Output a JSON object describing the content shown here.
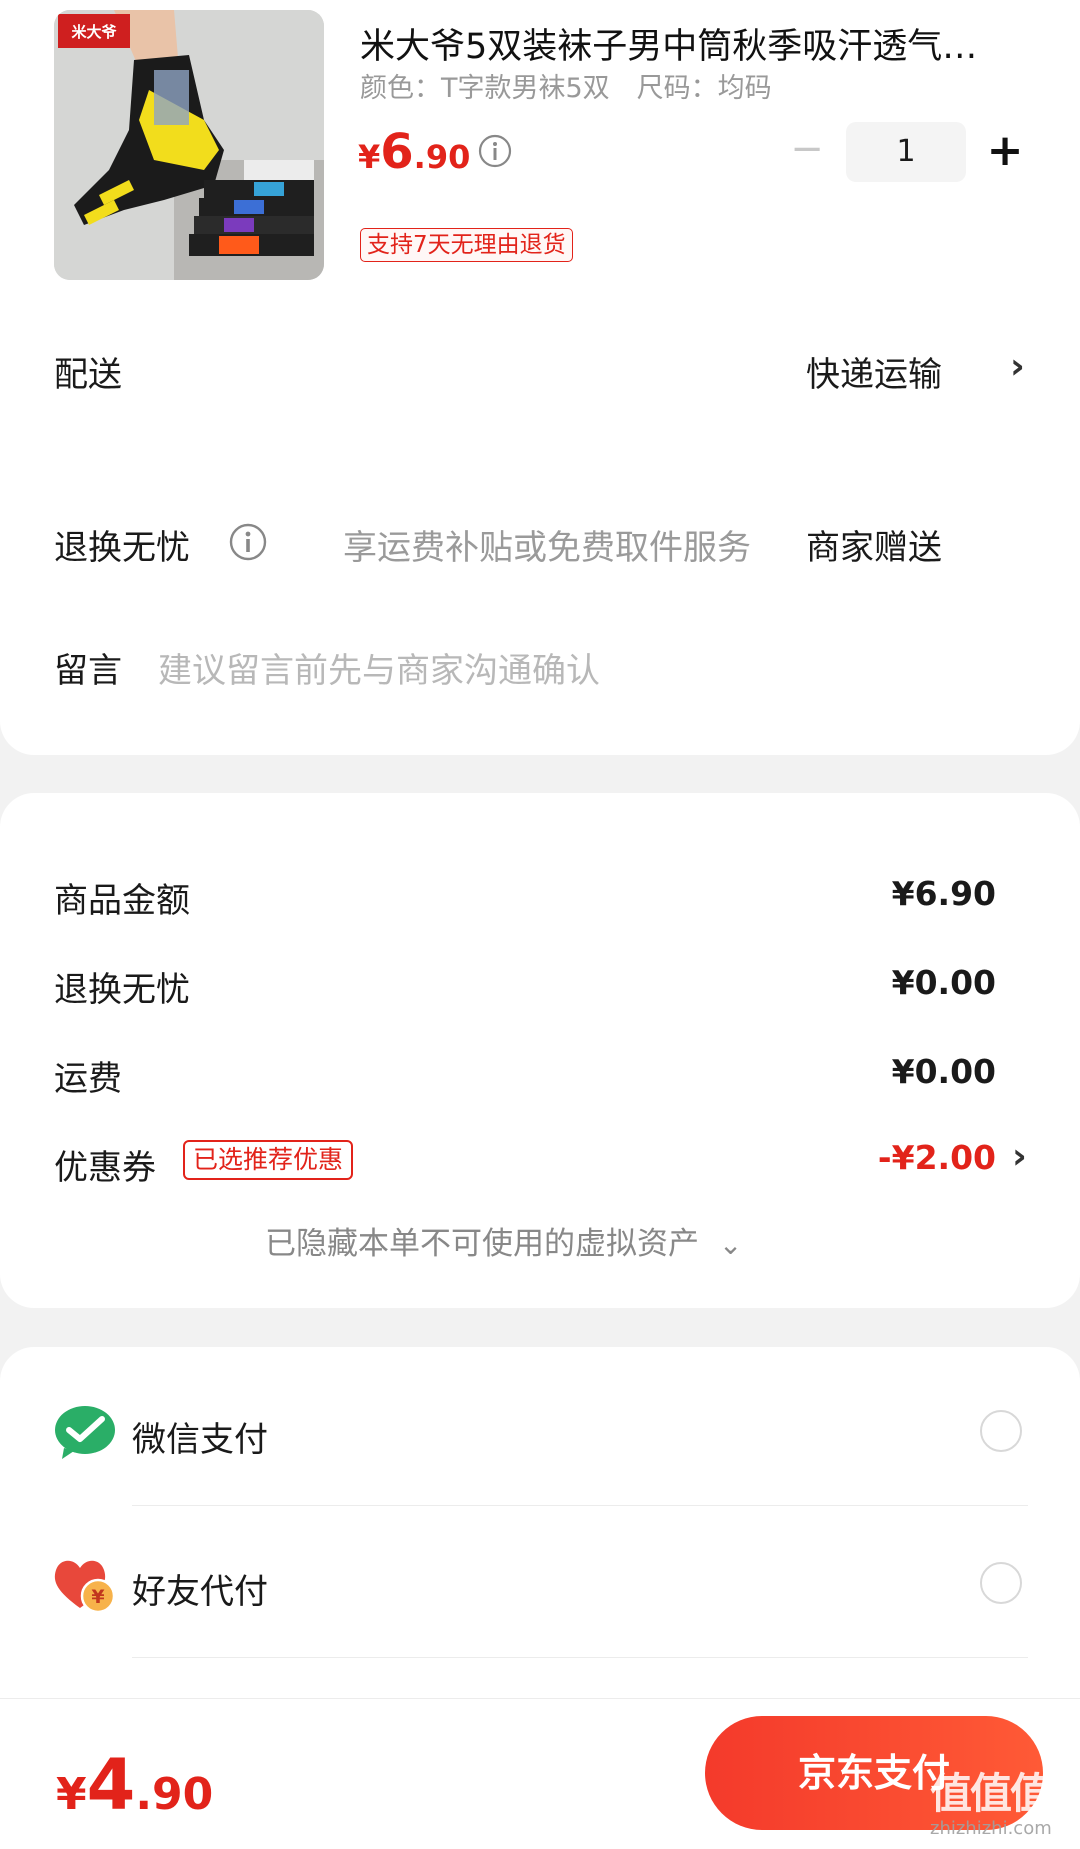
{
  "product": {
    "brand_tag": "米大爷",
    "title": "米大爷5双装袜子男中筒秋季吸汗透气…",
    "spec": "颜色：T字款男袜5双　尺码：均码",
    "price": {
      "currency": "¥",
      "integer": "6",
      "decimal": ".90"
    },
    "quantity": "1",
    "minus": "−",
    "plus": "+",
    "return_tag": "支持7天无理由退货"
  },
  "delivery": {
    "label": "配送",
    "value": "快递运输",
    "chevron": "›"
  },
  "worry_free": {
    "label": "退换无忧",
    "description": "享运费补贴或免费取件服务",
    "value": "商家赠送"
  },
  "note": {
    "label": "留言",
    "placeholder": "建议留言前先与商家沟通确认"
  },
  "summary": {
    "rows": [
      {
        "label": "商品金额",
        "amount": "¥6.90"
      },
      {
        "label": "退换无忧",
        "amount": "¥0.00"
      },
      {
        "label": "运费",
        "amount": "¥0.00"
      }
    ],
    "coupon": {
      "label": "优惠券",
      "tag": "已选推荐优惠",
      "amount": "-¥2.00",
      "chevron": "›"
    },
    "hidden_assets": "已隐藏本单不可使用的虚拟资产",
    "hidden_chevron": "⌄"
  },
  "payment": {
    "methods": [
      {
        "label": "微信支付",
        "icon": "wechat-pay-icon"
      },
      {
        "label": "好友代付",
        "icon": "friend-pay-icon"
      }
    ]
  },
  "footer": {
    "total": {
      "currency": "¥",
      "integer": "4",
      "decimal": ".90"
    },
    "pay_button": "京东支付",
    "watermark": "值值值",
    "watermark_url": "zhizhizhi.com"
  },
  "colors": {
    "accent": "#e2231a",
    "wechat_green": "#2aae67"
  }
}
